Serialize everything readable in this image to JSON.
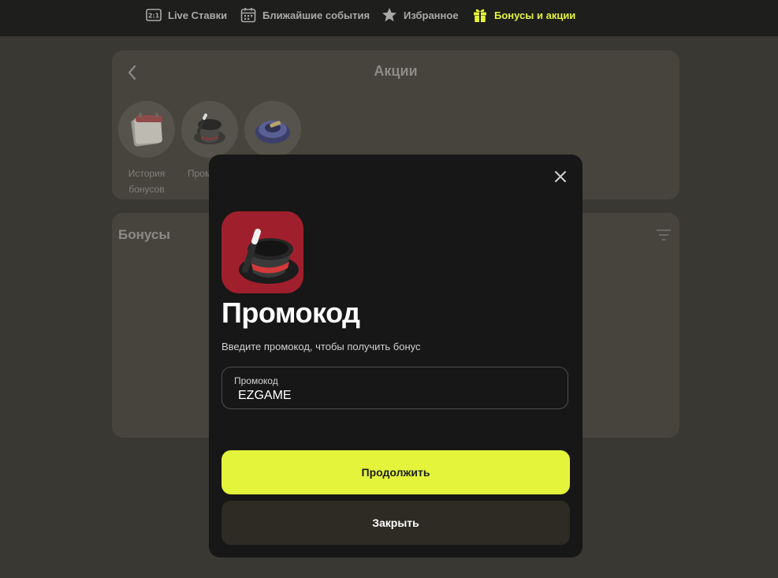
{
  "nav": {
    "items": [
      {
        "label": "Live Ставки",
        "icon": "live-2-1-icon"
      },
      {
        "label": "Ближайшие события",
        "icon": "calendar-icon"
      },
      {
        "label": "Избранное",
        "icon": "star-icon"
      },
      {
        "label": "Бонусы и акции",
        "icon": "gift-icon",
        "active": true
      }
    ],
    "live_badge": "2:1",
    "active_color": "#e6f23a"
  },
  "promotions": {
    "title": "Акции",
    "tiles": [
      {
        "label": "История бонусов",
        "icon": "calendar-history-icon"
      },
      {
        "label": "Пром",
        "icon": "magic-hat-icon"
      },
      {
        "label": "",
        "icon": "coin-box-icon"
      }
    ]
  },
  "bonuses": {
    "title": "Бонусы"
  },
  "modal": {
    "title": "Промокод",
    "subtitle": "Введите промокод, чтобы получить бонус",
    "input": {
      "label": "Промокод",
      "value": "EZGAME"
    },
    "continue_label": "Продолжить",
    "close_label": "Закрыть",
    "accent_color": "#e4f43b"
  }
}
